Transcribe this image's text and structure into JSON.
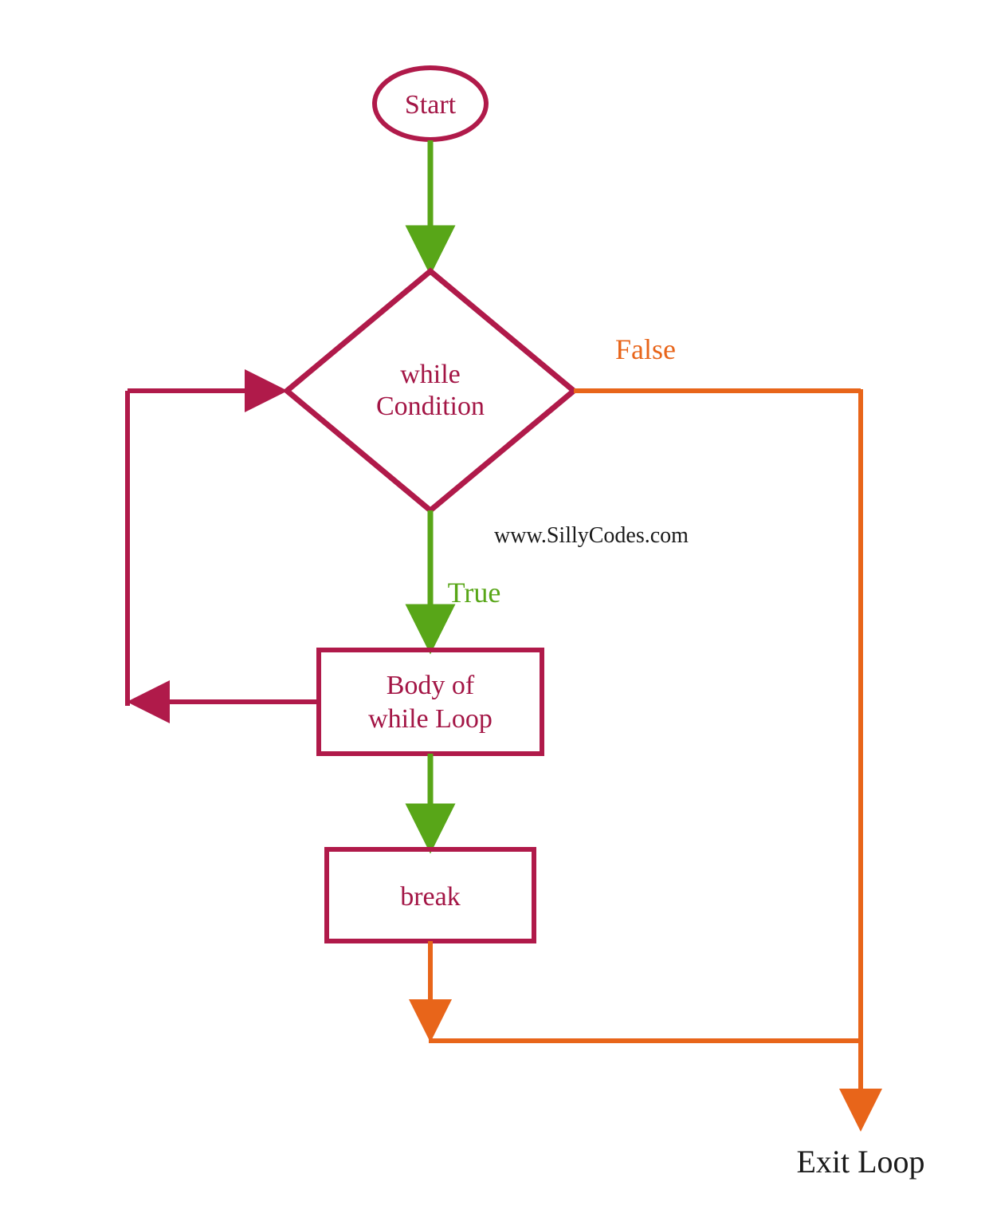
{
  "nodes": {
    "start": {
      "label": "Start"
    },
    "condition": {
      "line1": "while",
      "line2": "Condition"
    },
    "body": {
      "line1": "Body of",
      "line2": "while Loop"
    },
    "break": {
      "label": "break"
    }
  },
  "edges": {
    "true_label": "True",
    "false_label": "False"
  },
  "exit_label": "Exit Loop",
  "watermark": "www.SillyCodes.com",
  "colors": {
    "maroon": "#b01a4a",
    "green": "#58a618",
    "orange": "#e8651a",
    "text_dark": "#1a1a1a"
  }
}
